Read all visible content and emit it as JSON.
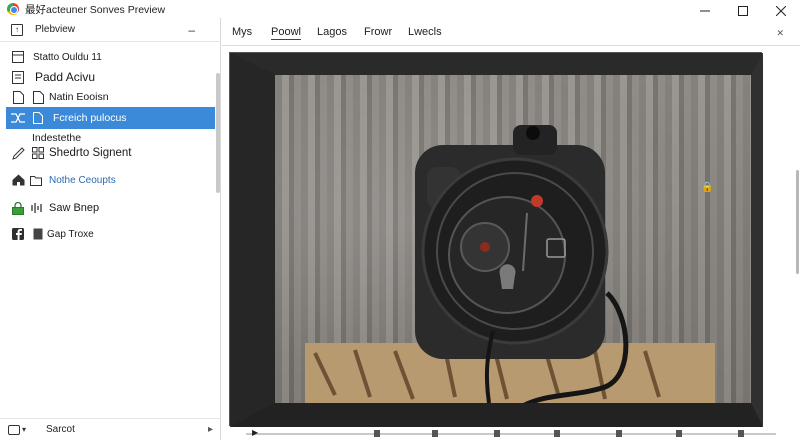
{
  "window": {
    "title": "最好acteuner Sonves Preview"
  },
  "sidebar": {
    "header_label": "Plebview",
    "collapse_symbol": "–",
    "items": [
      {
        "label": "Statto Ouldu 11",
        "icon": "layout-icon"
      },
      {
        "label": "Padd Acivu",
        "icon": "document-icon"
      },
      {
        "label": "Natin Eooisn",
        "icon": "page-icon"
      },
      {
        "label": "Fcreich pulocus",
        "icon": "shuffle-icon",
        "selected": true
      },
      {
        "label": "Indestethe",
        "icon": ""
      },
      {
        "label": "Shedrto Signent",
        "icon": "pencil-icon"
      },
      {
        "label": "Nothe Ceoupts",
        "icon": "home-icon"
      },
      {
        "label": "Saw Bnep",
        "icon": "lock-icon"
      },
      {
        "label": "Gap Troxe",
        "icon": "facebook-icon"
      }
    ],
    "footer_label": "Sarcot"
  },
  "tabs": [
    {
      "label": "Mys"
    },
    {
      "label": "Poowl",
      "active": true
    },
    {
      "label": "Lagos"
    },
    {
      "label": "Frowr"
    },
    {
      "label": "Lwecls"
    }
  ],
  "colors": {
    "selection": "#3b8ad9",
    "link_blue": "#2b6cb0",
    "preview_bg": "#1c1c1c"
  }
}
